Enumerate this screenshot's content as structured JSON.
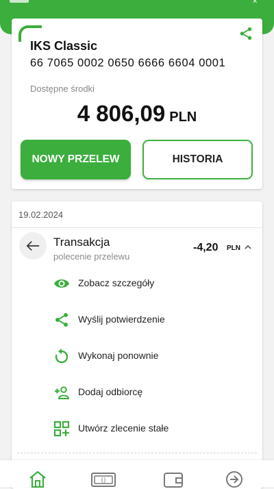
{
  "account": {
    "name": "IKS Classic",
    "number": "66 7065 0002 0650 6666 6604 0001",
    "available_label": "Dostępne środki",
    "balance_amount": "4 806,09",
    "balance_currency": "PLN",
    "new_transfer_label": "NOWY PRZELEW",
    "history_label": "HISTORIA"
  },
  "history": {
    "date": "19.02.2024",
    "transaction": {
      "title": "Transakcja",
      "subtitle": "polecenie przelewu",
      "amount": "-4,20",
      "currency": "PLN"
    },
    "actions": [
      {
        "label": "Zobacz szczegóły",
        "icon": "eye-icon"
      },
      {
        "label": "Wyślij potwierdzenie",
        "icon": "share-icon"
      },
      {
        "label": "Wykonaj ponownie",
        "icon": "repeat-icon"
      },
      {
        "label": "Dodaj odbiorcę",
        "icon": "add-person-icon"
      },
      {
        "label": "Utwórz zlecenie stałe",
        "icon": "standing-order-icon"
      }
    ]
  },
  "bottom_nav": [
    "home-icon",
    "banknote-icon",
    "wallet-icon",
    "arrow-circle-icon"
  ],
  "colors": {
    "brand_green": "#3bae3d",
    "background": "#f2f2f2",
    "card": "#ffffff",
    "text": "#1a1a1a",
    "muted": "#888888"
  }
}
